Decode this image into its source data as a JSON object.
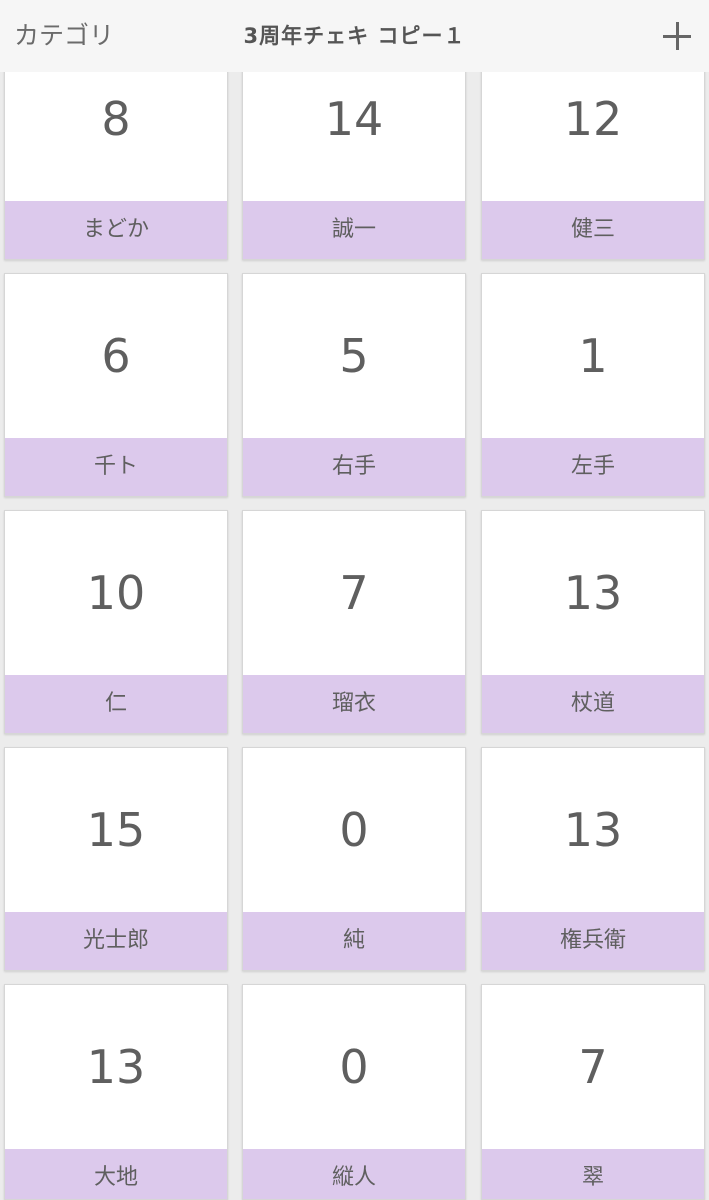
{
  "header": {
    "left_label": "カテゴリ",
    "title": "3周年チェキ コピー１",
    "add_label": "+"
  },
  "cards": [
    {
      "count": "8",
      "name": "まどか"
    },
    {
      "count": "14",
      "name": "誠一"
    },
    {
      "count": "12",
      "name": "健三"
    },
    {
      "count": "6",
      "name": "千ト"
    },
    {
      "count": "5",
      "name": "右手"
    },
    {
      "count": "1",
      "name": "左手"
    },
    {
      "count": "10",
      "name": "仁"
    },
    {
      "count": "7",
      "name": "瑠衣"
    },
    {
      "count": "13",
      "name": "杖道"
    },
    {
      "count": "15",
      "name": "光士郎"
    },
    {
      "count": "0",
      "name": "純"
    },
    {
      "count": "13",
      "name": "権兵衛"
    },
    {
      "count": "13",
      "name": "大地"
    },
    {
      "count": "0",
      "name": "縦人"
    },
    {
      "count": "7",
      "name": "翠"
    }
  ],
  "colors": {
    "label_background": "#dcc9ec",
    "header_background": "#f6f6f6",
    "page_background": "#ececec"
  }
}
